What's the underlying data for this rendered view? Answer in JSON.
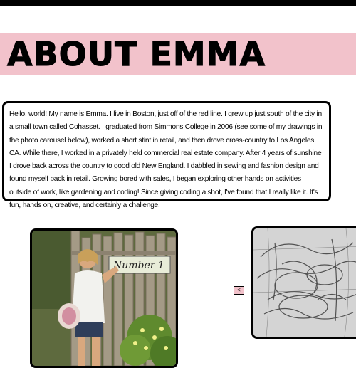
{
  "header": {
    "title": "ABOUT EMMA"
  },
  "bio": {
    "text": "Hello, world! My name is Emma. I live in Boston, just off of the red line. I grew up just south of the city in a small town called Cohasset. I graduated from Simmons College in 2006 (see some of my drawings in the photo carousel below), worked a short stint in retail, and then drove cross-country to Los Angeles, CA. While there, I worked in a privately held commercial real estate company. After 4 years of sunshine I drove back across the country to good old New England. I dabbled in sewing and fashion design and found myself back in retail. Growing bored with sales, I began exploring other hands on activities outside of work, like gardening and coding! Since giving coding a shot, I've found that I really like it. It's fun, hands on, creative, and certainly a challenge."
  },
  "photo": {
    "sign_text": "Number 1"
  },
  "carousel": {
    "prev_label": "<"
  },
  "colors": {
    "accent_pink": "#f2c2cb",
    "border": "#000000"
  }
}
